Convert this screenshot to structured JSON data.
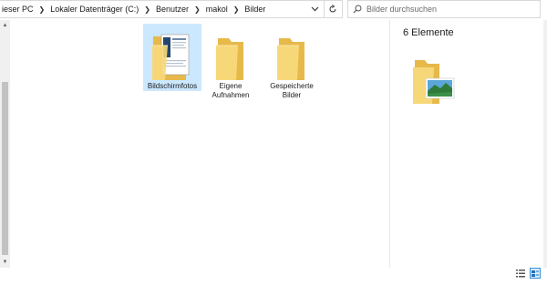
{
  "breadcrumb": {
    "items": [
      "ieser PC",
      "Lokaler Datenträger (C:)",
      "Benutzer",
      "makol",
      "Bilder"
    ]
  },
  "search": {
    "placeholder": "Bilder durchsuchen"
  },
  "files": [
    {
      "name": "Bildschirmfotos",
      "type": "folder-with-document",
      "selected": true
    },
    {
      "name": "Eigene Aufnahmen",
      "type": "folder"
    },
    {
      "name": "Gespeicherte Bilder",
      "type": "folder"
    }
  ],
  "preview": {
    "count_label": "6 Elemente",
    "icon": "pictures-folder-icon"
  },
  "colors": {
    "folder": "#f3d06b",
    "folder_light": "#fbe49b",
    "selection": "#cce8ff",
    "accent": "#3c8fd6"
  }
}
